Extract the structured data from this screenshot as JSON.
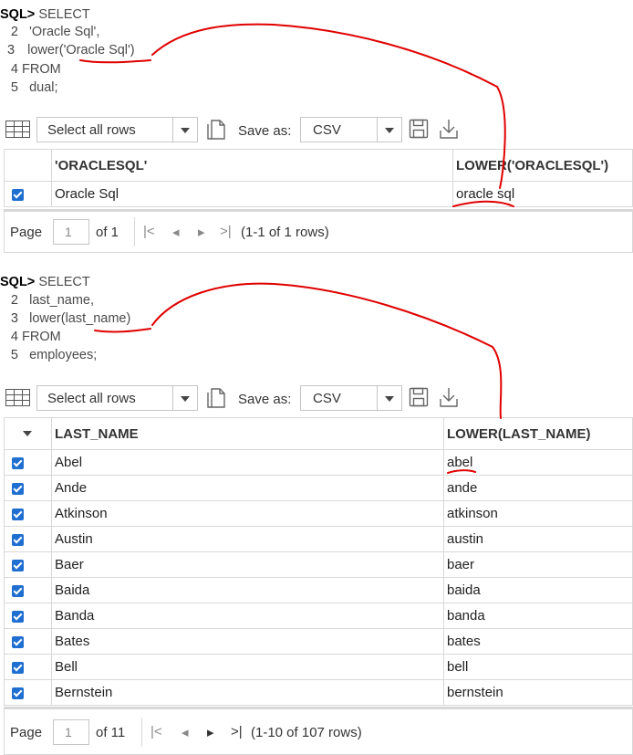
{
  "query1": {
    "prompt": "SQL>",
    "lines": [
      {
        "num": "",
        "text": "SELECT"
      },
      {
        "num": "2",
        "text": "'Oracle Sql',"
      },
      {
        "num": "3",
        "text": "lower('Oracle Sql')"
      },
      {
        "num": "4",
        "text": "FROM"
      },
      {
        "num": "5",
        "text": "dual;"
      }
    ]
  },
  "toolbar1": {
    "select_value": "Select all rows",
    "save_as_label": "Save as:",
    "format_value": "CSV"
  },
  "result1": {
    "columns": [
      "'ORACLESQL'",
      "LOWER('ORACLESQL')"
    ],
    "rows": [
      [
        "Oracle Sql",
        "oracle sql"
      ]
    ]
  },
  "pager1": {
    "page_label": "Page",
    "page_value": "1",
    "of_label": "of 1",
    "rows_text": "(1-1 of 1 rows)"
  },
  "query2": {
    "prompt": "SQL>",
    "lines": [
      {
        "num": "",
        "text": "SELECT"
      },
      {
        "num": "2",
        "text": "last_name,"
      },
      {
        "num": "3",
        "text": "lower(last_name)"
      },
      {
        "num": "4",
        "text": "FROM"
      },
      {
        "num": "5",
        "text": "employees;"
      }
    ]
  },
  "toolbar2": {
    "select_value": "Select all rows",
    "save_as_label": "Save as:",
    "format_value": "CSV"
  },
  "result2": {
    "columns": [
      "LAST_NAME",
      "LOWER(LAST_NAME)"
    ],
    "rows": [
      [
        "Abel",
        "abel"
      ],
      [
        "Ande",
        "ande"
      ],
      [
        "Atkinson",
        "atkinson"
      ],
      [
        "Austin",
        "austin"
      ],
      [
        "Baer",
        "baer"
      ],
      [
        "Baida",
        "baida"
      ],
      [
        "Banda",
        "banda"
      ],
      [
        "Bates",
        "bates"
      ],
      [
        "Bell",
        "bell"
      ],
      [
        "Bernstein",
        "bernstein"
      ]
    ]
  },
  "pager2": {
    "page_label": "Page",
    "page_value": "1",
    "of_label": "of 11",
    "rows_text": "(1-10 of 107 rows)"
  },
  "colors": {
    "annotation": "#e00000",
    "checkbox": "#1f6fd1"
  }
}
